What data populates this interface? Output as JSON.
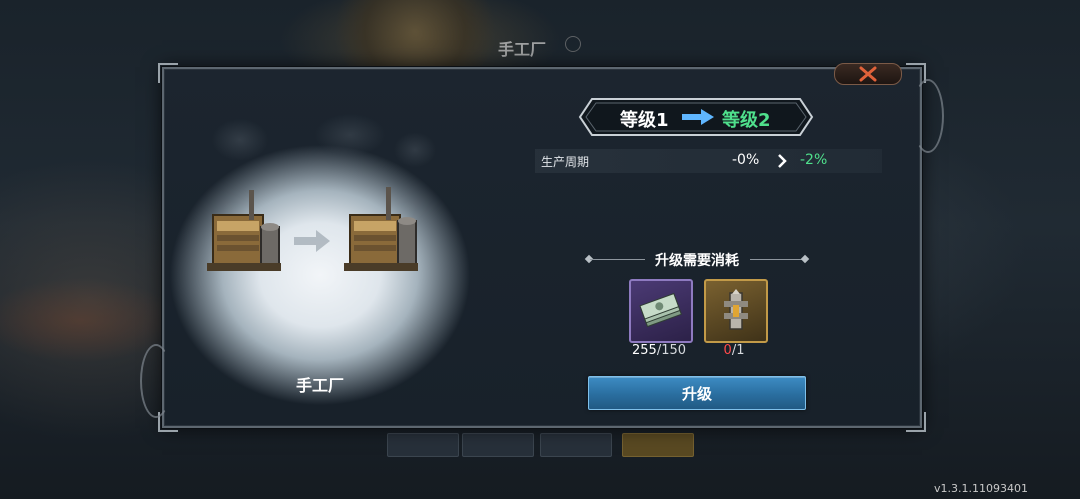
{
  "background": {
    "screen_title": "手工厂",
    "version": "v1.3.1.11093401"
  },
  "panel": {
    "building_name": "手工厂",
    "level_from": "等级1",
    "level_to": "等级2",
    "stat": {
      "label": "生产周期",
      "from": "-0%",
      "to": "-2%"
    },
    "cost_title": "升级需要消耗",
    "costs": [
      {
        "item": "cash-bundle-icon",
        "have": "255",
        "need": "/150",
        "sufficient": true
      },
      {
        "item": "machine-part-icon",
        "have": "0",
        "need": "/1",
        "sufficient": false
      }
    ],
    "upgrade_label": "升级"
  },
  "colors": {
    "accent_green": "#4fe08c",
    "insufficient_red": "#ff4a4a",
    "button_blue": "#2a6e9f"
  }
}
